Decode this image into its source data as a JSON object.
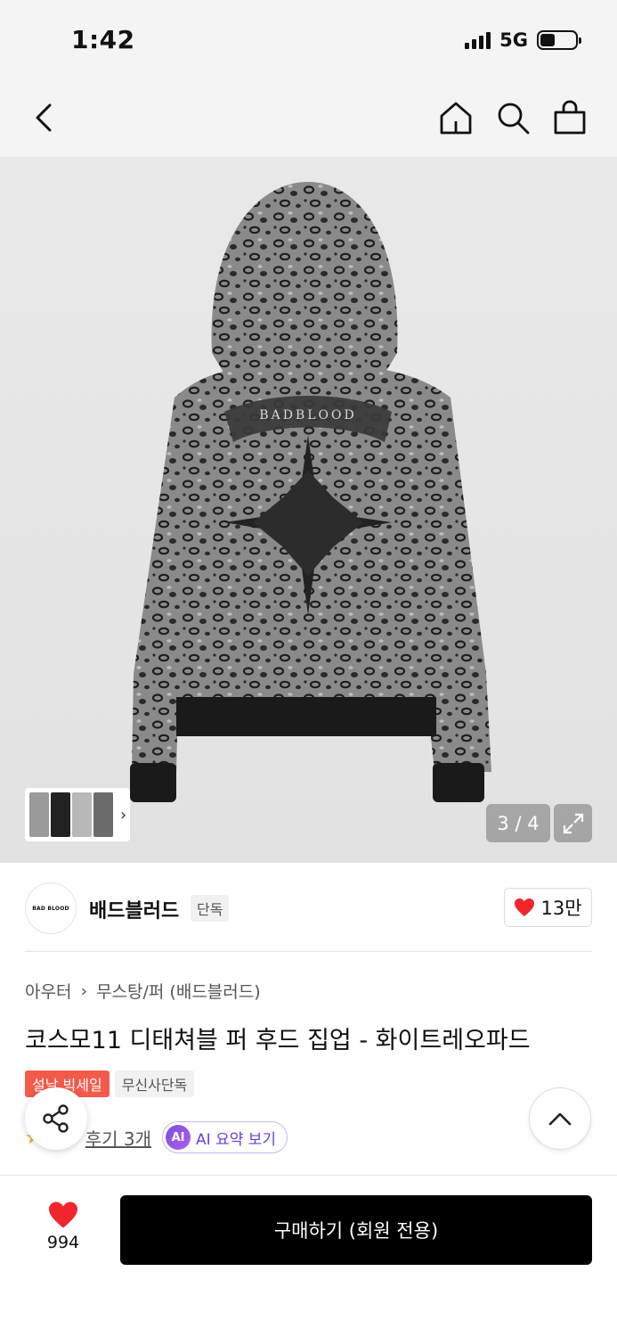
{
  "status_bar": {
    "time": "1:42",
    "network": "5G"
  },
  "nav": {
    "back_icon": "chevron-left-icon",
    "home_icon": "home-icon",
    "search_icon": "search-icon",
    "cart_icon": "shopping-bag-icon"
  },
  "gallery": {
    "counter": "3 / 4",
    "expand_icon": "expand-icon",
    "thumbnail_chevron": "›",
    "embroidery_text": "BADBLOOD"
  },
  "brand": {
    "logo_text": "BAD BLOOD",
    "name": "배드블러드",
    "tag": "단독",
    "like_count": "13만"
  },
  "product": {
    "breadcrumb": [
      "아우터",
      "무스탕/퍼 (배드블러드)"
    ],
    "title": "코스모11 디태쳐블 퍼 후드 집업 - 화이트레오파드",
    "badges": {
      "sale": "설날 빅세일",
      "exclusive": "무신사단독"
    },
    "review_link": "후기 3개",
    "ai_badge": "AI",
    "ai_summary": "AI 요약 보기"
  },
  "bottom_bar": {
    "wish_count": "994",
    "buy_label": "구매하기 (회원 전용)"
  },
  "colors": {
    "accent_red": "#f0262c",
    "sale_badge": "#f25b4a",
    "ai_purple": "#6b3fd9",
    "buy_button": "#000000"
  }
}
